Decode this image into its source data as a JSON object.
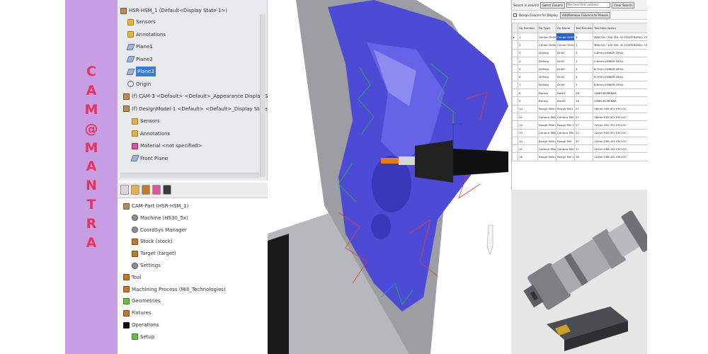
{
  "brand": {
    "letters": [
      "C",
      "A",
      "M",
      "@",
      "M",
      "A",
      "N",
      "T",
      "R",
      "A"
    ],
    "background": "#c79ee3",
    "letter_color": "#e8325e"
  },
  "feature_tree": {
    "title": "HSR-HSM_1 (Default<Display State-1>)",
    "items": [
      {
        "label": "Sensors",
        "icon": "folder-icon"
      },
      {
        "label": "Annotations",
        "icon": "folder-icon"
      },
      {
        "label": "Plane1",
        "icon": "plane-icon"
      },
      {
        "label": "Plane2",
        "icon": "plane-icon"
      },
      {
        "label": "Plane3",
        "icon": "plane-icon",
        "selected": true
      },
      {
        "label": "Origin",
        "icon": "origin-icon"
      },
      {
        "label": "(f) CAM-3 <Default> <Default>_Appearance Display Stat",
        "icon": "part-icon"
      },
      {
        "label": "(f) DesignModel-1 <Default> <Default>_Display State 1>",
        "icon": "part-icon"
      },
      {
        "label": "Sensors",
        "icon": "folder-icon"
      },
      {
        "label": "Annotations",
        "icon": "folder-icon"
      },
      {
        "label": "Material <not specified>",
        "icon": "material-icon"
      },
      {
        "label": "Front Plane",
        "icon": "plane-icon"
      }
    ]
  },
  "cam_tree": {
    "items": [
      {
        "label": "CAM-Part (HSR-HSM_1)",
        "icon": "part-icon"
      },
      {
        "label": "Machine (HS30_5x)",
        "icon": "gear-icon"
      },
      {
        "label": "CoordSys Manager",
        "icon": "gear-icon"
      },
      {
        "label": "Stock (stock)",
        "icon": "tool-icon"
      },
      {
        "label": "Target (target)",
        "icon": "tool-icon"
      },
      {
        "label": "Settings",
        "icon": "gear-icon"
      },
      {
        "label": "Tool",
        "icon": "tool-icon"
      },
      {
        "label": "Machining Process (Mill_Technologies)",
        "icon": "tool-icon"
      },
      {
        "label": "Geometries",
        "icon": "green-icon"
      },
      {
        "label": "Fixtures",
        "icon": "tool-icon"
      },
      {
        "label": "Operations",
        "icon": "black-icon"
      },
      {
        "label": "Setup",
        "icon": "green-icon"
      }
    ]
  },
  "ops_table": {
    "search_label": "Search in column",
    "select_column_label": "Select Column",
    "search_placeholder": "the text that contains",
    "clear_button": "Clear Search",
    "checkbox_label": "Assign Column for Display",
    "add_remove_label": "Add/Remove Columns to Reason",
    "columns": [
      "Op Number",
      "Op Type",
      "Op Name",
      "Tool Number",
      "Tool Description"
    ],
    "rows": [
      [
        "1",
        "Center Drilling",
        "Center Drill1",
        "1",
        "MAN 90 / 100 CHL 45 CENTERDRILL CENTER"
      ],
      [
        "2",
        "Center Drilling",
        "Center Drill1",
        "1",
        "MAN 90 / 100 CHL 45 CENTERDRILL CENTER"
      ],
      [
        "3",
        "Drilling",
        "Drill1",
        "3",
        "5.8mm JOBBER DRILL"
      ],
      [
        "4",
        "Drilling",
        "Drill2",
        "3",
        "5.8mm JOBBER DRILL"
      ],
      [
        "5",
        "Drilling",
        "Drill3",
        "4",
        "6.7mm JOBBER DRILL"
      ],
      [
        "6",
        "Drilling",
        "Drill4",
        "4",
        "6.7mm JOBBER DRILL"
      ],
      [
        "7",
        "Drilling",
        "Drill5",
        "5",
        "6.8mm JOBBER DRILL"
      ],
      [
        "8",
        "Boring",
        "Bore1",
        "26",
        "10MM BOREBAR"
      ],
      [
        "9",
        "Boring",
        "Bore2",
        "26",
        "10MM BOREBAR"
      ],
      [
        "10",
        "Rough Milling",
        "Rough Mill1",
        "27",
        "16mm HSS 3FL EM LOC"
      ],
      [
        "11",
        "Contour Milling",
        "Contour Mill1",
        "27",
        "16mm HSS 3FL EM LOC"
      ],
      [
        "12",
        "Rough Milling",
        "Rough Mill 1",
        "27",
        "12mm HSS 3FL EM LOC"
      ],
      [
        "13",
        "Contour Milling",
        "Contour Mill 1",
        "27",
        "12mm HSS 3FL EM LOC"
      ],
      [
        "14",
        "Rough Milling",
        "Rough Mill",
        "37",
        "12mm CRB 4FL EM LOC"
      ],
      [
        "15",
        "Contour Milling",
        "Contour Mill",
        "37",
        "12mm CRB 4FL EM LOC"
      ],
      [
        "16",
        "Rough Milling",
        "Rough Mill 5",
        "38",
        "12mm CRB 4FL EM LOC"
      ]
    ],
    "selected_cell": "Center Drill1",
    "selection_color": "#2a63c9"
  },
  "viewport": {
    "model_color": "#4d4ad6",
    "stock_color": "#b7b8bd",
    "toolpath_colors": [
      "#e23b3b",
      "#2bb84a",
      "#1f3fcf"
    ],
    "tool_tip_color": "#e87a1e"
  }
}
